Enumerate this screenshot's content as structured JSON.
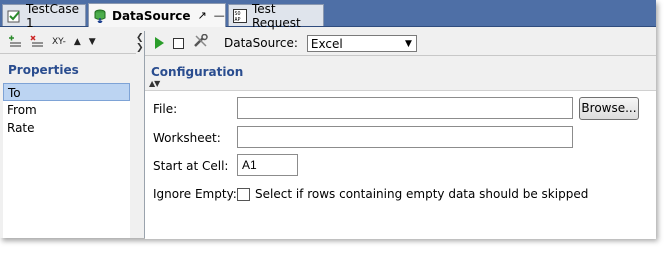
{
  "tabs": [
    {
      "label": "TestCase 1",
      "icon": "testcase-check-icon"
    },
    {
      "label": "DataSource",
      "icon": "datasource-icon",
      "controls": [
        "pin-icon",
        "minimize-icon",
        "close-icon"
      ]
    },
    {
      "label": "Test Request",
      "icon": "soap-request-icon"
    }
  ],
  "left_toolbar": {
    "add_icon": "add-property-icon",
    "remove_icon": "remove-property-icon",
    "rename_text": "XY-",
    "up_icon": "move-up-icon",
    "down_icon": "move-down-icon"
  },
  "properties": {
    "title": "Properties",
    "items": [
      "To",
      "From",
      "Rate"
    ],
    "selected_index": 0
  },
  "toolbar": {
    "run_icon": "run-icon",
    "stop_icon": "stop-icon",
    "options_icon": "wrench-icon",
    "datasource_label": "DataSource:",
    "datasource_value": "Excel"
  },
  "configuration": {
    "title": "Configuration",
    "file_label": "File:",
    "file_value": "",
    "browse_label": "Browse...",
    "worksheet_label": "Worksheet:",
    "worksheet_value": "",
    "start_cell_label": "Start at Cell:",
    "start_cell_value": "A1",
    "ignore_empty_label": "Ignore Empty:",
    "ignore_empty_text": "Select if rows containing empty data should be skipped",
    "ignore_empty_checked": false
  },
  "colors": {
    "tabbar": "#4e6fa6",
    "heading": "#2a4d8f",
    "selection": "#bcd4f2",
    "run": "#2a9d2a"
  }
}
